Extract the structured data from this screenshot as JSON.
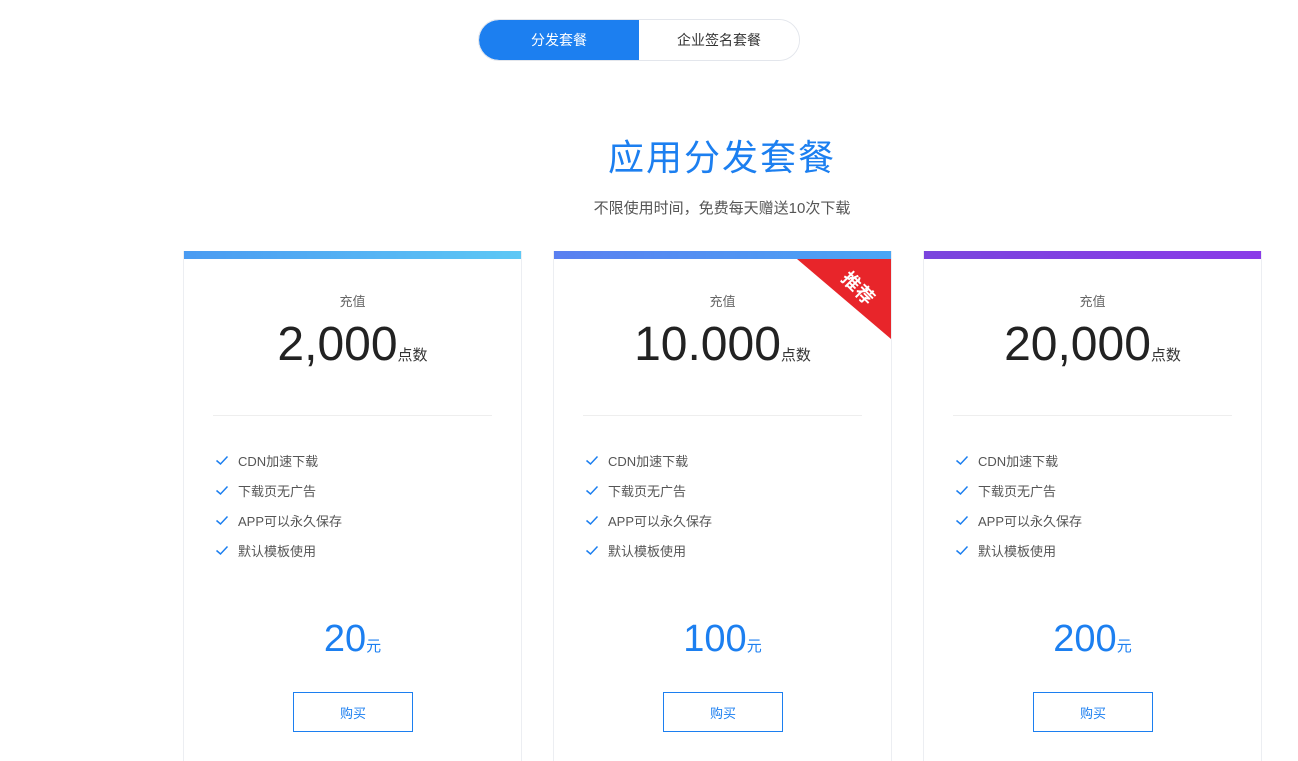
{
  "tabs": [
    {
      "label": "分发套餐",
      "active": true
    },
    {
      "label": "企业签名套餐",
      "active": false
    }
  ],
  "section": {
    "title": "应用分发套餐",
    "subtitle": "不限使用时间，免费每天赠送10次下载"
  },
  "colors": {
    "accent": "#1c7ff0",
    "ribbon": "#e8252a"
  },
  "plans": [
    {
      "label": "充值",
      "amount": "2,000",
      "amount_unit": "点数",
      "features": [
        "CDN加速下载",
        "下载页无广告",
        "APP可以永久保存",
        "默认模板使用"
      ],
      "price": "20",
      "price_unit": "元",
      "buy_label": "购买",
      "bar_gradient": [
        "#4a9bf2",
        "#5ec8f5"
      ]
    },
    {
      "label": "充值",
      "amount": "10.000",
      "amount_unit": "点数",
      "features": [
        "CDN加速下载",
        "下载页无广告",
        "APP可以永久保存",
        "默认模板使用"
      ],
      "price": "100",
      "price_unit": "元",
      "buy_label": "购买",
      "badge": "推荐",
      "bar_gradient": [
        "#5a7ff0",
        "#4aa6f5"
      ]
    },
    {
      "label": "充值",
      "amount": "20,000",
      "amount_unit": "点数",
      "features": [
        "CDN加速下载",
        "下载页无广告",
        "APP可以永久保存",
        "默认模板使用"
      ],
      "price": "200",
      "price_unit": "元",
      "buy_label": "购买",
      "bar_gradient": [
        "#7a45dd",
        "#8a3be8"
      ]
    }
  ]
}
